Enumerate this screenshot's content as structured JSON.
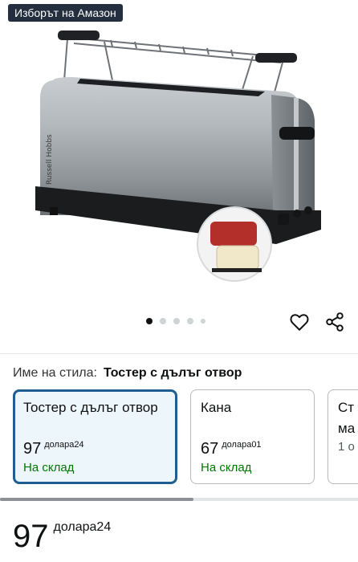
{
  "badge": "Изборът на Амазон",
  "gallery": {
    "image_count": 5,
    "active_index": 0
  },
  "style": {
    "label": "Име на стила:",
    "selected": "Тостер с дълъг отвор"
  },
  "cards": [
    {
      "title": "Тостер с дълъг отвор",
      "price_whole": "97",
      "price_cur": "долара24",
      "stock": "На склад"
    },
    {
      "title": "Кана",
      "price_whole": "67",
      "price_cur": "долара01",
      "stock": "На склад"
    },
    {
      "title": "Ст",
      "subtitle": "ма",
      "extra": "1 о"
    }
  ],
  "price": {
    "whole": "97",
    "currency": "долара24"
  },
  "brand_on_product": "Russell Hobbs",
  "scroll_progress": 0.54,
  "colors": {
    "badge_bg": "#232f3e",
    "selected_border": "#1f5e93",
    "selected_bg": "#edf6fb",
    "stock": "#007600"
  }
}
